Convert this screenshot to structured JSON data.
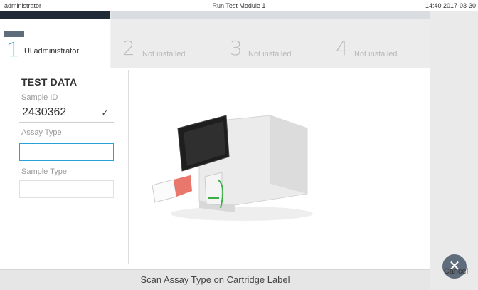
{
  "topbar": {
    "user": "administrator",
    "title": "Run Test Module 1",
    "clock": "14:40 2017-03-30"
  },
  "tabs": [
    {
      "number": "1",
      "label": "Ul administrator",
      "active": true
    },
    {
      "number": "2",
      "label": "Not installed",
      "active": false
    },
    {
      "number": "3",
      "label": "Not installed",
      "active": false
    },
    {
      "number": "4",
      "label": "Not installed",
      "active": false
    }
  ],
  "test_data": {
    "title": "TEST DATA",
    "sample_id_label": "Sample ID",
    "sample_id_value": "2430362",
    "sample_id_check": "✓",
    "assay_type_label": "Assay Type",
    "assay_type_value": "",
    "sample_type_label": "Sample Type",
    "sample_type_value": ""
  },
  "status": {
    "message": "Scan Assay Type on Cartridge Label"
  },
  "actions": {
    "cancel_label": "Cancel",
    "cancel_icon": "close-icon"
  },
  "colors": {
    "accent": "#2aa1d6",
    "button": "#5f6c7b",
    "background": "#f2f2f2"
  }
}
